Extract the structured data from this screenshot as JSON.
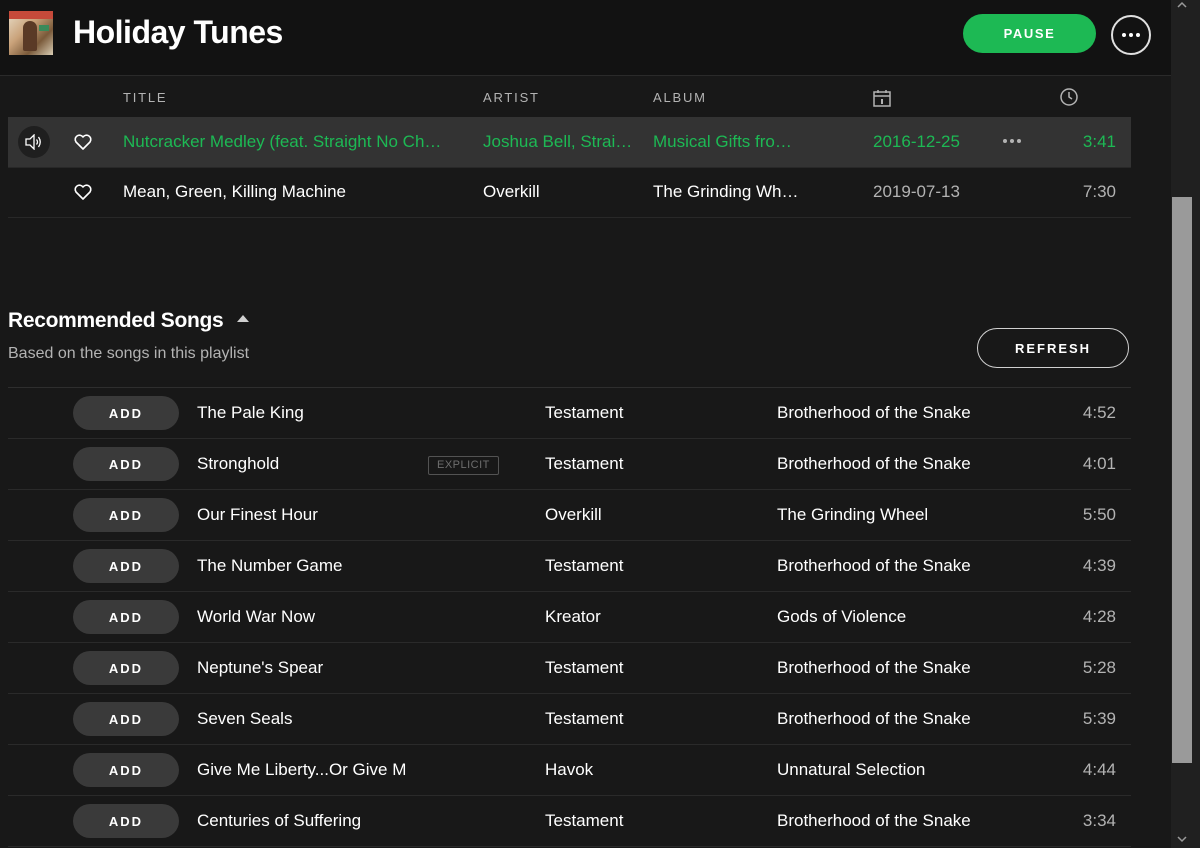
{
  "playlist": {
    "title": "Holiday Tunes",
    "pause_label": "PAUSE"
  },
  "columns": {
    "title": "TITLE",
    "artist": "ARTIST",
    "album": "ALBUM"
  },
  "tracks": [
    {
      "title": "Nutcracker Medley (feat. Straight No Ch…",
      "artist": "Joshua Bell, Strai…",
      "album": "Musical Gifts fro…",
      "date": "2016-12-25",
      "duration": "3:41",
      "playing": true
    },
    {
      "title": "Mean, Green, Killing Machine",
      "artist": "Overkill",
      "album": "The Grinding Wh…",
      "date": "2019-07-13",
      "duration": "7:30",
      "playing": false
    }
  ],
  "recommended": {
    "title": "Recommended Songs",
    "subtitle": "Based on the songs in this playlist",
    "refresh_label": "REFRESH",
    "add_label": "ADD",
    "explicit_label": "EXPLICIT",
    "songs": [
      {
        "title": "The Pale King",
        "artist": "Testament",
        "album": "Brotherhood of the Snake",
        "duration": "4:52"
      },
      {
        "title": "Stronghold",
        "artist": "Testament",
        "album": "Brotherhood of the Snake",
        "duration": "4:01",
        "explicit": true
      },
      {
        "title": "Our Finest Hour",
        "artist": "Overkill",
        "album": "The Grinding Wheel",
        "duration": "5:50"
      },
      {
        "title": "The Number Game",
        "artist": "Testament",
        "album": "Brotherhood of the Snake",
        "duration": "4:39"
      },
      {
        "title": "World War Now",
        "artist": "Kreator",
        "album": "Gods of Violence",
        "duration": "4:28"
      },
      {
        "title": "Neptune's Spear",
        "artist": "Testament",
        "album": "Brotherhood of the Snake",
        "duration": "5:28"
      },
      {
        "title": "Seven Seals",
        "artist": "Testament",
        "album": "Brotherhood of the Snake",
        "duration": "5:39"
      },
      {
        "title": "Give Me Liberty...Or Give M",
        "artist": "Havok",
        "album": "Unnatural Selection",
        "duration": "4:44"
      },
      {
        "title": "Centuries of Suffering",
        "artist": "Testament",
        "album": "Brotherhood of the Snake",
        "duration": "3:34"
      }
    ]
  },
  "colors": {
    "accent": "#1db954",
    "background": "#181818",
    "header_bg": "#121212",
    "active_row": "#333333"
  },
  "icons": [
    "speaker-icon",
    "heart-icon",
    "calendar-icon",
    "clock-icon",
    "more-icon",
    "caret-up-icon"
  ]
}
